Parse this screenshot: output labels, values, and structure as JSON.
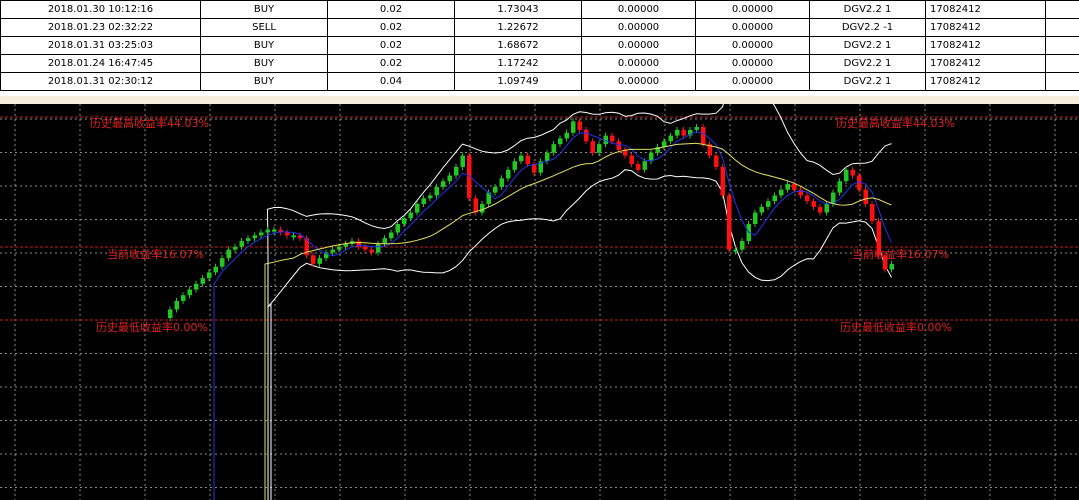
{
  "trades": {
    "rows": [
      {
        "time": "2018.01.30 10:12:16",
        "type": "BUY",
        "size": "0.02",
        "price": "1.73043",
        "sl": "0.00000",
        "tp": "0.00000",
        "comment": "DGV2.2  1",
        "id": "17082412"
      },
      {
        "time": "2018.01.23 02:32:22",
        "type": "SELL",
        "size": "0.02",
        "price": "1.22672",
        "sl": "0.00000",
        "tp": "0.00000",
        "comment": "DGV2.2  -1",
        "id": "17082412"
      },
      {
        "time": "2018.01.31 03:25:03",
        "type": "BUY",
        "size": "0.02",
        "price": "1.68672",
        "sl": "0.00000",
        "tp": "0.00000",
        "comment": "DGV2.2  1",
        "id": "17082412"
      },
      {
        "time": "2018.01.24 16:47:45",
        "type": "BUY",
        "size": "0.02",
        "price": "1.17242",
        "sl": "0.00000",
        "tp": "0.00000",
        "comment": "DGV2.2  1",
        "id": "17082412"
      },
      {
        "time": "2018.01.31 02:30:12",
        "type": "BUY",
        "size": "0.04",
        "price": "1.09749",
        "sl": "0.00000",
        "tp": "0.00000",
        "comment": "DGV2.2  1",
        "id": "17082412"
      }
    ]
  },
  "chart": {
    "labels": {
      "max_left": "历史最高收益率44.03%",
      "max_right": "历史最高收益率44.03%",
      "cur_left": "当前收益率16.07%",
      "cur_right": "当前收益率16.07%",
      "min_left": "历史最低收益率0.00%",
      "min_right": "历史最低收益率0.00%"
    },
    "colors": {
      "up": "#22c822",
      "down": "#ff1010",
      "level_line": "#c81e1e",
      "grid": "#8a8a8a",
      "ma_blue": "#2233ee",
      "ma_yellow": "#e8e060",
      "band": "#ffffff"
    },
    "closes": [
      3,
      6,
      8,
      10,
      12,
      14,
      16,
      18,
      21,
      24,
      25,
      27,
      28,
      29,
      30,
      31,
      31,
      30,
      29,
      29,
      28,
      22,
      19,
      21,
      23,
      24,
      25,
      26,
      27,
      25,
      24,
      23,
      26,
      28,
      30,
      33,
      35,
      37,
      40,
      42,
      43,
      46,
      48,
      50,
      53,
      57,
      42,
      37,
      40,
      44,
      46,
      49,
      52,
      55,
      57,
      54,
      51,
      55,
      58,
      61,
      63,
      65,
      69,
      66,
      62,
      58,
      61,
      64,
      62,
      59,
      57,
      54,
      52,
      55,
      58,
      60,
      62,
      64,
      66,
      64,
      66,
      67,
      61,
      57,
      53,
      43,
      24,
      24,
      27,
      33,
      37,
      39,
      41,
      43,
      45,
      47,
      45,
      43,
      41,
      39,
      37,
      40,
      44,
      48,
      52,
      50,
      45,
      40,
      34,
      22,
      17,
      19
    ]
  }
}
